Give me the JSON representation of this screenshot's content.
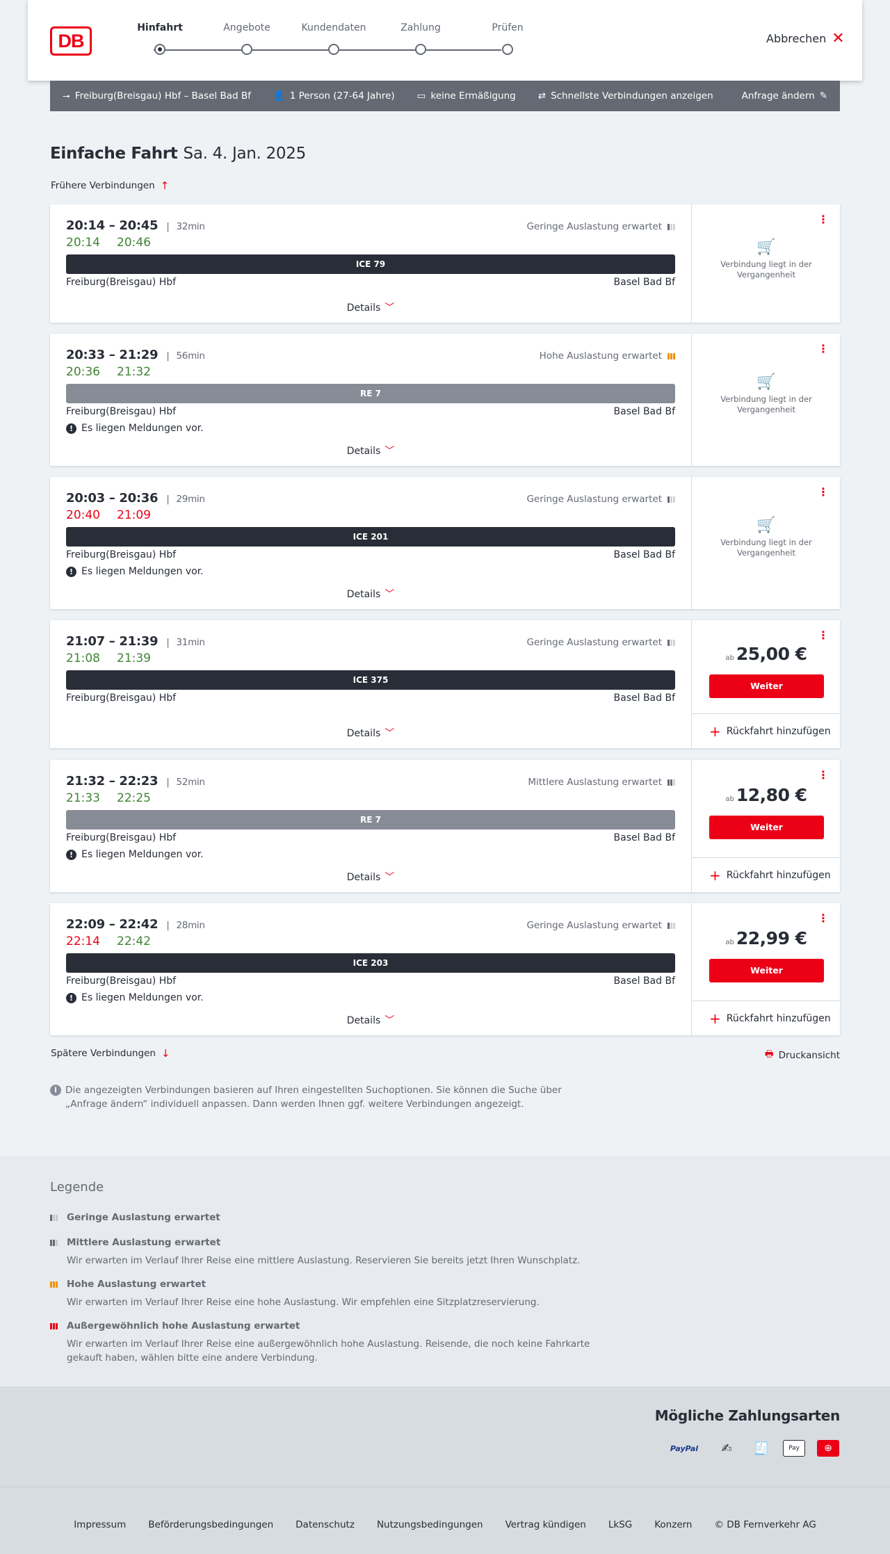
{
  "header": {
    "logo": "DB",
    "steps": [
      "Hinfahrt",
      "Angebote",
      "Kundendaten",
      "Zahlung",
      "Prüfen"
    ],
    "cancel_label": "Abbrechen"
  },
  "search_bar": {
    "route": "Freiburg(Breisgau) Hbf – Basel Bad Bf",
    "passengers": "1 Person (27-64 Jahre)",
    "discount": "keine Ermäßigung",
    "fastest": "Schnellste Verbindungen anzeigen",
    "edit": "Anfrage ändern"
  },
  "page": {
    "title": "Einfache Fahrt",
    "date": "Sa. 4. Jan. 2025",
    "earlier": "Frühere Verbindungen",
    "later": "Spätere Verbindungen",
    "print": "Druckansicht",
    "info": "Die angezeigten Verbindungen basieren auf Ihren eingestellten Suchoptionen. Sie können die Suche über „Anfrage ändern“ individuell anpassen. Dann werden Ihnen ggf. weitere Verbindungen angezeigt."
  },
  "common": {
    "details": "Details",
    "from": "Freiburg(Breisgau) Hbf",
    "to": "Basel Bad Bf",
    "message": "Es liegen Meldungen vor.",
    "past": "Verbindung liegt in der Vergangenheit",
    "ab": "ab",
    "weiter": "Weiter",
    "return": "Rückfahrt hinzufügen"
  },
  "connections": [
    {
      "times": "20:14 – 20:45",
      "duration": "32min",
      "rt_dep": "20:14",
      "rt_arr": "20:46",
      "occupancy": "Geringe Auslastung erwartet",
      "train": "ICE 79"
    },
    {
      "times": "20:33 – 21:29",
      "duration": "56min",
      "rt_dep": "20:36",
      "rt_arr": "21:32",
      "occupancy": "Hohe Auslastung erwartet",
      "train": "RE 7"
    },
    {
      "times": "20:03 – 20:36",
      "duration": "29min",
      "rt_dep": "20:40",
      "rt_arr": "21:09",
      "occupancy": "Geringe Auslastung erwartet",
      "train": "ICE 201"
    },
    {
      "times": "21:07 – 21:39",
      "duration": "31min",
      "rt_dep": "21:08",
      "rt_arr": "21:39",
      "occupancy": "Geringe Auslastung erwartet",
      "train": "ICE 375",
      "price": "25,00 €"
    },
    {
      "times": "21:32 – 22:23",
      "duration": "52min",
      "rt_dep": "21:33",
      "rt_arr": "22:25",
      "occupancy": "Mittlere Auslastung erwartet",
      "train": "RE 7",
      "price": "12,80 €"
    },
    {
      "times": "22:09 – 22:42",
      "duration": "28min",
      "rt_dep": "22:14",
      "rt_arr": "22:42",
      "occupancy": "Geringe Auslastung erwartet",
      "train": "ICE 203",
      "price": "22,99 €"
    }
  ],
  "legend": {
    "title": "Legende",
    "items": [
      {
        "head": "Geringe Auslastung erwartet",
        "desc": ""
      },
      {
        "head": "Mittlere Auslastung erwartet",
        "desc": "Wir erwarten im Verlauf Ihrer Reise eine mittlere Auslastung. Reservieren Sie bereits jetzt Ihren Wunschplatz."
      },
      {
        "head": "Hohe Auslastung erwartet",
        "desc": "Wir erwarten im Verlauf Ihrer Reise eine hohe Auslastung. Wir empfehlen eine Sitzplatzreservierung."
      },
      {
        "head": "Außergewöhnlich hohe Auslastung erwartet",
        "desc": "Wir erwarten im Verlauf Ihrer Reise eine außergewöhnlich hohe Auslastung. Reisende, die noch keine Fahrkarte gekauft haben, wählen bitte eine andere Verbindung."
      }
    ]
  },
  "payment": {
    "title": "Mögliche Zahlungsarten",
    "methods": [
      "PayPal",
      "Lastschrift",
      "Rechnung",
      "Apple Pay",
      "DB"
    ]
  },
  "footer": {
    "links": [
      "Impressum",
      "Beförderungsbedingungen",
      "Datenschutz",
      "Nutzungsbedingungen",
      "Vertrag kündigen",
      "LkSG",
      "Konzern",
      "© DB Fernverkehr AG"
    ]
  },
  "colors": {
    "brand_red": "#ec0016",
    "on_time": "#408335",
    "dark_bar": "#282d37",
    "regional_bar": "#878c96",
    "high_load": "#f39200"
  }
}
